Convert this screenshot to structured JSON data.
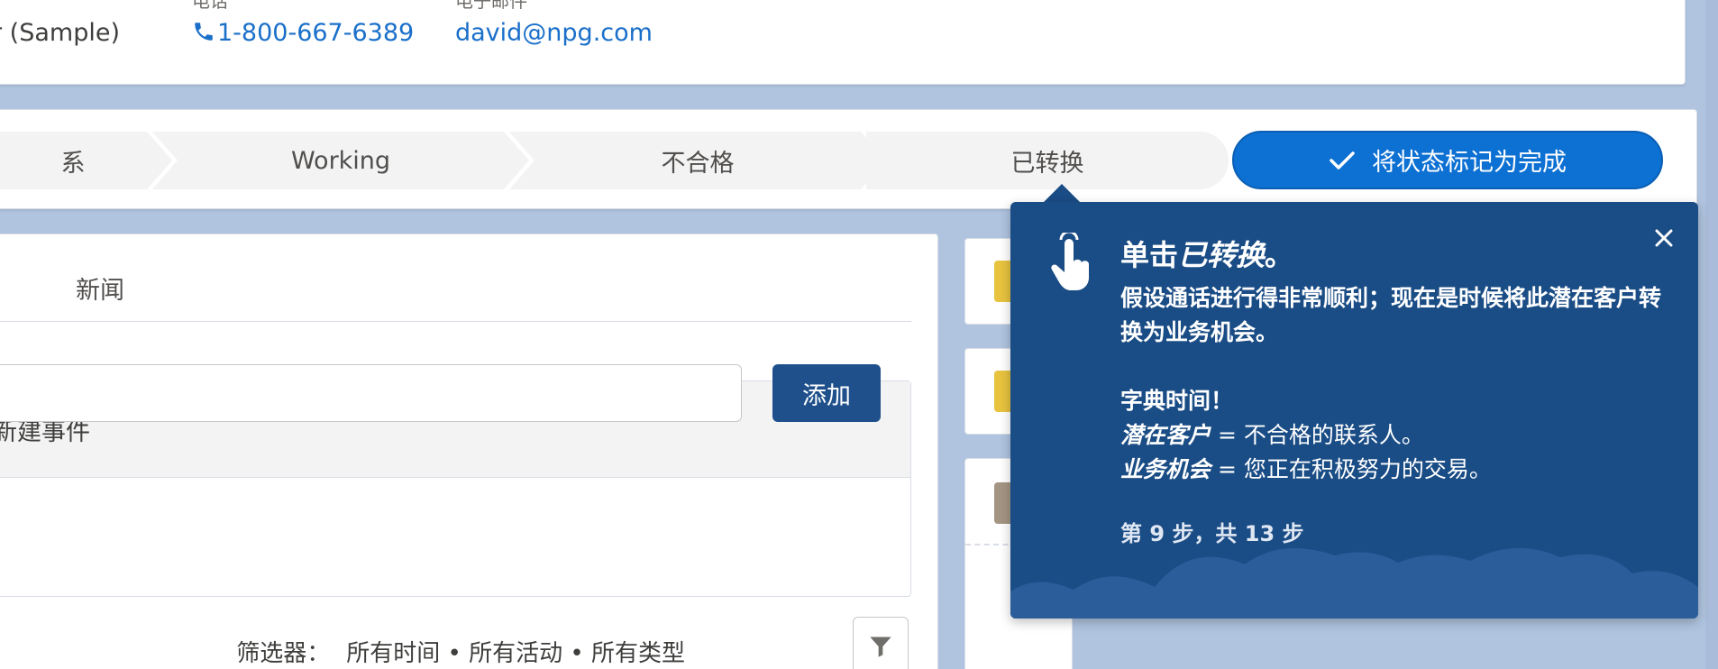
{
  "header": {
    "title_fragment": "r (Sample)",
    "phone_label": "电话",
    "phone_value": "1-800-667-6389",
    "email_label": "电子邮件",
    "email_value": "david@npg.com"
  },
  "path": {
    "stages": [
      "系",
      "Working",
      "不合格",
      "已转换"
    ],
    "mark_button_label": "将状态标记为完成"
  },
  "activity": {
    "tab_news": "新闻",
    "composer_title": "新建事件",
    "add_button": "添加",
    "filter_label": "筛选器：",
    "filter_value": "所有时间 • 所有活动 • 所有类型"
  },
  "popover": {
    "title_prefix": "单击",
    "title_emphasis": "已转换",
    "title_suffix": "。",
    "body_line1": "假设通话进行得非常顺利；现在是时候将此潜在客户转换为业务机会。",
    "dict_heading": "字典时间！",
    "dict1_term": "潜在客户",
    "dict1_def": " = 不合格的联系人。",
    "dict2_term": "业务机会",
    "dict2_def": " = 您正在积极努力的交易。",
    "step_text": "第 9 步，共 13 步"
  },
  "colors": {
    "background": "#b0c4df",
    "primary_blue": "#0d70d3",
    "popover_bg": "#1a4c85",
    "brand_dark": "#1f508b",
    "link": "#1a6fc9"
  }
}
